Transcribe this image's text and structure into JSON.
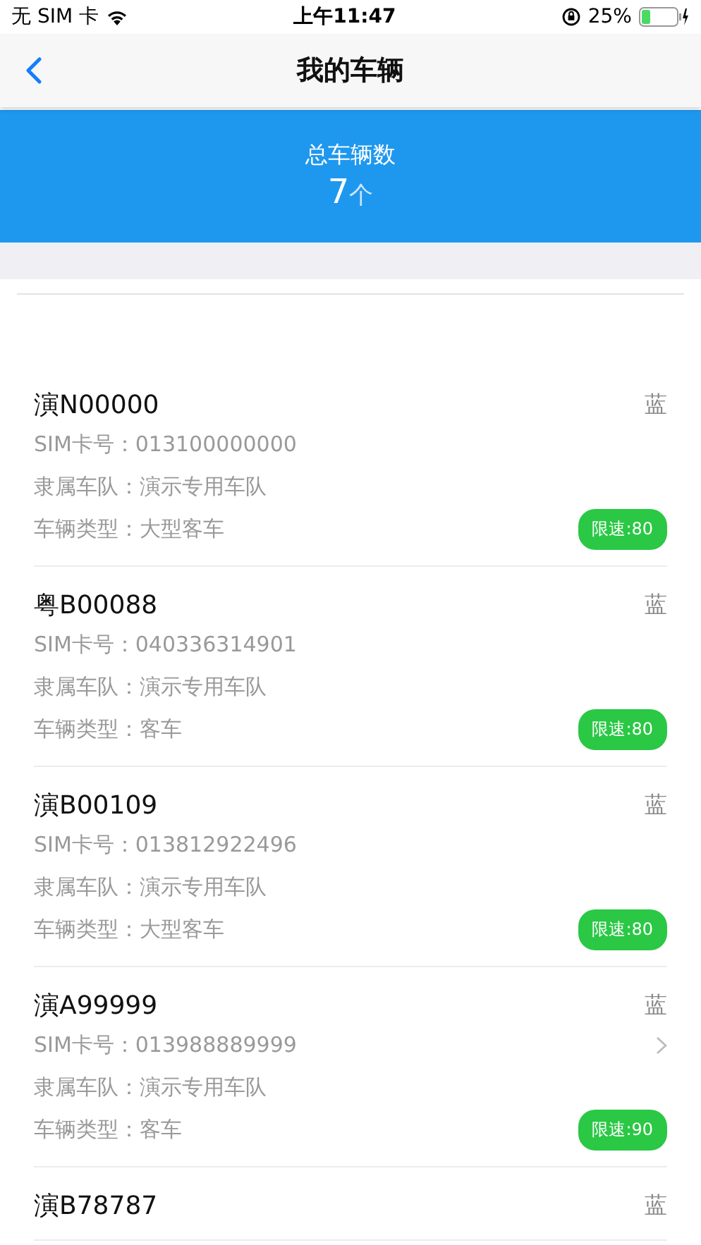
{
  "status_bar": {
    "carrier": "无 SIM 卡",
    "time": "上午11:47",
    "battery_percent": "25%",
    "battery": {
      "level": 0.25
    }
  },
  "nav": {
    "title": "我的车辆"
  },
  "summary": {
    "label": "总车辆数",
    "count": "7",
    "unit": "个"
  },
  "vehicles": [
    {
      "plate": "演N00000",
      "plate_color": "蓝",
      "sim": "SIM卡号：013100000000",
      "fleet": "隶属车队：演示专用车队",
      "type": "车辆类型：大型客车",
      "speed_limit": "限速:80",
      "chevron": false
    },
    {
      "plate": "粤B00088",
      "plate_color": "蓝",
      "sim": "SIM卡号：040336314901",
      "fleet": "隶属车队：演示专用车队",
      "type": "车辆类型：客车",
      "speed_limit": "限速:80",
      "chevron": false
    },
    {
      "plate": "演B00109",
      "plate_color": "蓝",
      "sim": "SIM卡号：013812922496",
      "fleet": "隶属车队：演示专用车队",
      "type": "车辆类型：大型客车",
      "speed_limit": "限速:80",
      "chevron": false
    },
    {
      "plate": "演A99999",
      "plate_color": "蓝",
      "sim": "SIM卡号：013988889999",
      "fleet": "隶属车队：演示专用车队",
      "type": "车辆类型：客车",
      "speed_limit": "限速:90",
      "chevron": true
    },
    {
      "plate": "演B78787",
      "plate_color": "蓝"
    }
  ]
}
